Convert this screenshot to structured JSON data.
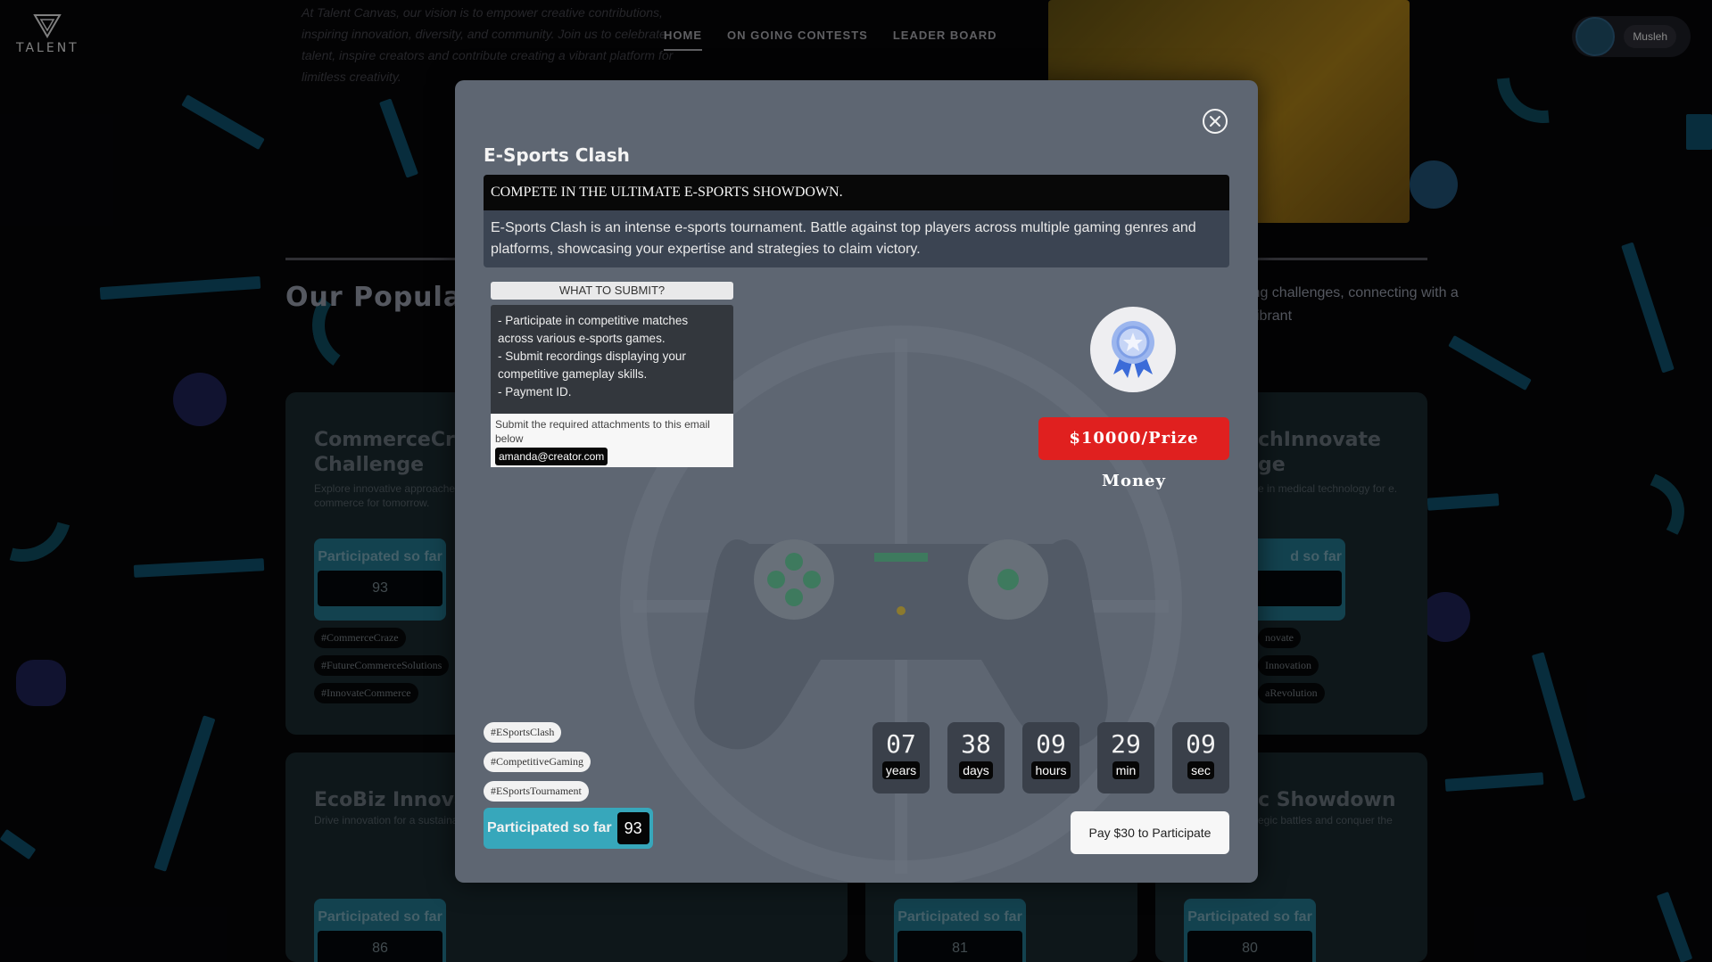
{
  "nav": {
    "logo_text": "TALENT",
    "intro_text": "At Talent Canvas, our vision is to empower creative contributions, inspiring innovation, diversity, and community. Join us to celebrate talent, inspire creators and contribute creating a vibrant platform for limitless creativity.",
    "links": [
      "HOME",
      "ON GOING CONTESTS",
      "LEADER BOARD"
    ],
    "user_name": "Musleh"
  },
  "section": {
    "title": "Our Popular C",
    "desc": "ing challenges, connecting with a vibrant"
  },
  "cards": [
    {
      "title": "CommerceCraze Challenge",
      "desc": "Explore innovative approaches to commerce for tomorrow.",
      "participated_label": "Participated so far",
      "count": "93",
      "tags": [
        "#CommerceCraze",
        "#FutureCommerceSolutions",
        "#InnovateCommerce"
      ]
    },
    {
      "title": "chInnovate ge",
      "desc": "e in medical technology for e.",
      "participated_label": "d so far",
      "count": "",
      "tags": [
        "novate",
        "Innovation",
        "aRevolution"
      ]
    },
    {
      "title": "EcoBiz Innovate",
      "desc": "Drive innovation for a sustaina",
      "participated_label": "Participated so far",
      "count": "86",
      "tags": []
    },
    {
      "title": "",
      "desc": "",
      "participated_label": "Participated so far",
      "count": "81",
      "tags": []
    },
    {
      "title": "c Showdown",
      "desc": "egic battles and conquer the",
      "participated_label": "Participated so far",
      "count": "80",
      "tags": []
    }
  ],
  "modal": {
    "title": "E-Sports Clash",
    "headline": "COMPETE IN THE ULTIMATE E-SPORTS SHOWDOWN.",
    "description": "E-Sports Clash is an intense e-sports tournament. Battle against top players across multiple gaming genres and platforms, showcasing your expertise and strategies to claim victory.",
    "what_to_submit_label": "WHAT TO SUBMIT?",
    "requirements": [
      "- Participate in competitive matches across various e-sports games.",
      "- Submit recordings displaying your competitive gameplay skills.",
      "- Payment ID."
    ],
    "submit_note": "Submit the required attachments to this email below",
    "email": "amanda@creator.com",
    "prize": "$10000/Prize Money",
    "tags": [
      "#ESportsClash",
      "#CompetitiveGaming",
      "#ESportsTournament"
    ],
    "participated_label": "Participated so far",
    "participated_count": "93",
    "countdown": [
      {
        "value": "07",
        "unit": "years"
      },
      {
        "value": "38",
        "unit": "days"
      },
      {
        "value": "09",
        "unit": "hours"
      },
      {
        "value": "29",
        "unit": "min"
      },
      {
        "value": "09",
        "unit": "sec"
      }
    ],
    "pay_button": "Pay $30 to Participate"
  },
  "colors": {
    "modal_bg": "#5e6672",
    "prize_red": "#e0201f",
    "participated_teal": "#37a7bb"
  }
}
